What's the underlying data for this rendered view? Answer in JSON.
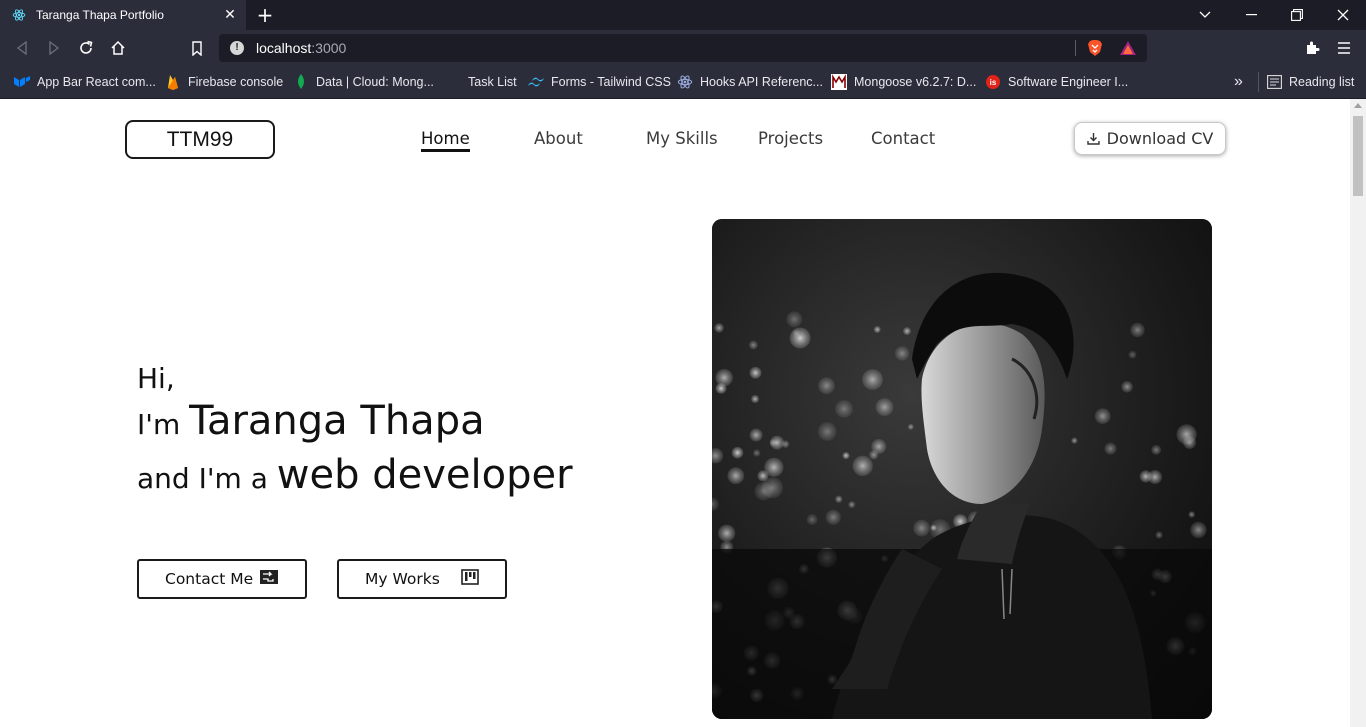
{
  "browser": {
    "tab_title": "Taranga Thapa Portfolio",
    "url_host": "localhost",
    "url_port": ":3000",
    "bookmarks": [
      {
        "label": "App Bar React com...",
        "icon": "mui-icon"
      },
      {
        "label": "Firebase console",
        "icon": "firebase-icon"
      },
      {
        "label": "Data | Cloud: Mong...",
        "icon": "mongodb-icon"
      },
      {
        "label": "Task List",
        "icon": "blank-icon"
      },
      {
        "label": "Forms - Tailwind CSS",
        "icon": "tailwind-icon"
      },
      {
        "label": "Hooks API Referenc...",
        "icon": "react-icon"
      },
      {
        "label": "Mongoose v6.2.7: D...",
        "icon": "mongoose-icon"
      },
      {
        "label": "Software Engineer I...",
        "icon": "software-icon"
      }
    ],
    "more_bookmarks": "»",
    "reading_list": "Reading list"
  },
  "site": {
    "logo": "TTM99",
    "nav": [
      {
        "label": "Home",
        "active": true
      },
      {
        "label": "About",
        "active": false
      },
      {
        "label": "My Skills",
        "active": false
      },
      {
        "label": "Projects",
        "active": false
      },
      {
        "label": "Contact",
        "active": false
      }
    ],
    "download_cv": "Download CV"
  },
  "hero": {
    "greeting": "Hi,",
    "im": "I'm",
    "name": "Taranga Thapa",
    "and_im": "and I'm a",
    "role": "web developer",
    "contact_button": "Contact Me",
    "works_button": "My Works"
  },
  "colors": {
    "chrome_dark": "#1c1c26",
    "chrome": "#2b2d3a",
    "text": "#111111"
  }
}
